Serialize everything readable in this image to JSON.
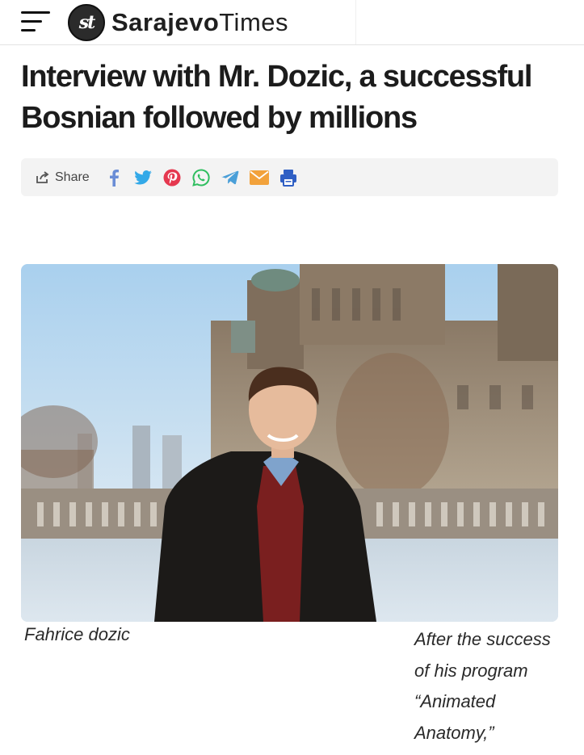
{
  "header": {
    "menu_icon": "hamburger-menu-icon",
    "logo_mark": "st",
    "logo_word_bold": "Sarajevo",
    "logo_word_light": "Times"
  },
  "article": {
    "title": "Interview with Mr. Dozic, a successful Bosnian followed by millions"
  },
  "share_bar": {
    "label": "Share",
    "icons": [
      "share-icon",
      "facebook-icon",
      "twitter-icon",
      "pinterest-icon",
      "whatsapp-icon",
      "telegram-icon",
      "email-icon",
      "print-icon"
    ],
    "colors": {
      "facebook": "#6a8dd6",
      "twitter": "#33a9e8",
      "pinterest": "#e5384f",
      "whatsapp": "#2fbe5f",
      "telegram": "#4a9fd8",
      "email": "#f2a23b",
      "print": "#2f5fc4"
    }
  },
  "photo": {
    "caption": "Fahrice dozic"
  },
  "side_text": {
    "line1": "After the success",
    "line2": "of his program",
    "line3": "“Animated",
    "line4": "Anatomy,”"
  }
}
